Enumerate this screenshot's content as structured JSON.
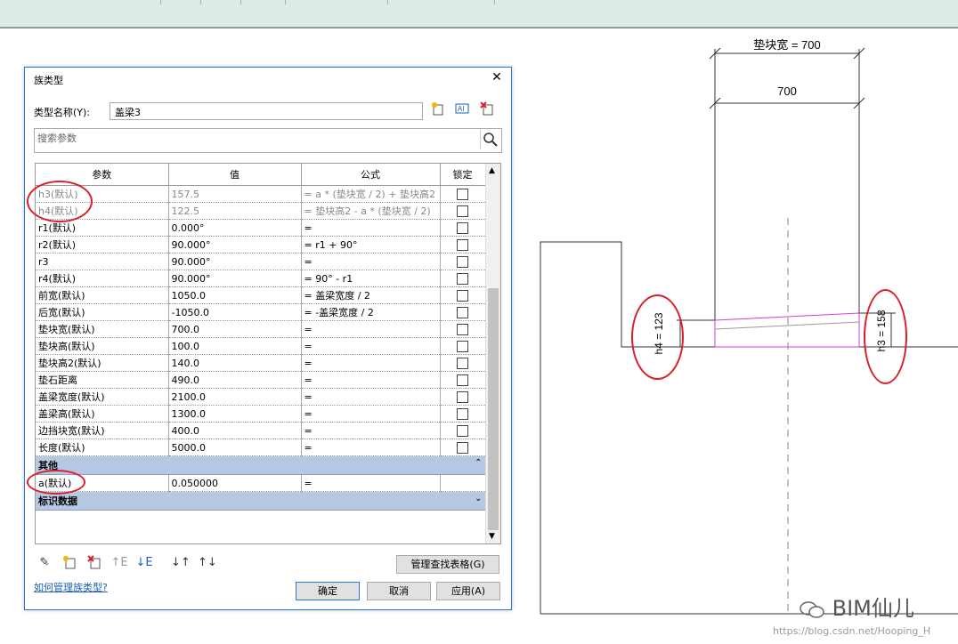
{
  "dialog": {
    "title": "族类型",
    "close_glyph": "✕",
    "type_name_label": "类型名称(Y):",
    "type_name_value": "盖梁3",
    "search_placeholder": "搜索参数",
    "columns": [
      "参数",
      "值",
      "公式",
      "锁定"
    ],
    "rows": [
      {
        "param": "h3(默认)",
        "value": "157.5",
        "formula": "= a * (垫块宽 / 2) + 垫块高2",
        "dim": true
      },
      {
        "param": "h4(默认)",
        "value": "122.5",
        "formula": "= 垫块高2 - a * (垫块宽 / 2)",
        "dim": true
      },
      {
        "param": "r1(默认)",
        "value": "0.000°",
        "formula": "=",
        "dim": false
      },
      {
        "param": "r2(默认)",
        "value": "90.000°",
        "formula": "= r1 + 90°",
        "dim": false
      },
      {
        "param": "r3",
        "value": "90.000°",
        "formula": "=",
        "dim": false
      },
      {
        "param": "r4(默认)",
        "value": "90.000°",
        "formula": "= 90° - r1",
        "dim": false
      },
      {
        "param": "前宽(默认)",
        "value": "1050.0",
        "formula": "= 盖梁宽度 / 2",
        "dim": false
      },
      {
        "param": "后宽(默认)",
        "value": "-1050.0",
        "formula": "= -盖梁宽度 / 2",
        "dim": false
      },
      {
        "param": "垫块宽(默认)",
        "value": "700.0",
        "formula": "=",
        "dim": false
      },
      {
        "param": "垫块高(默认)",
        "value": "100.0",
        "formula": "=",
        "dim": false
      },
      {
        "param": "垫块高2(默认)",
        "value": "140.0",
        "formula": "=",
        "dim": false
      },
      {
        "param": "垫石距离",
        "value": "490.0",
        "formula": "=",
        "dim": false
      },
      {
        "param": "盖梁宽度(默认)",
        "value": "2100.0",
        "formula": "=",
        "dim": false
      },
      {
        "param": "盖梁高(默认)",
        "value": "1300.0",
        "formula": "=",
        "dim": false
      },
      {
        "param": "边挡块宽(默认)",
        "value": "400.0",
        "formula": "=",
        "dim": false
      },
      {
        "param": "长度(默认)",
        "value": "5000.0",
        "formula": "=",
        "dim": false
      }
    ],
    "group_other": "其他",
    "row_a": {
      "param": "a(默认)",
      "value": "0.050000",
      "formula": "="
    },
    "group_identity": "标识数据",
    "manage_lookup_button": "管理查找表格(G)",
    "help_link": "如何管理族类型?",
    "ok_button": "确定",
    "cancel_button": "取消",
    "apply_button": "应用(A)"
  },
  "drawing": {
    "dim_top": "垫块宽 = 700",
    "dim_700": "700",
    "dim_h4": "h4 = 123",
    "dim_h3": "h3 = 158"
  },
  "watermark": {
    "brand": "BIM仙儿",
    "url": "https://blog.csdn.net/Hooping_H"
  },
  "colors": {
    "accent": "#2c78c8",
    "annotation": "#d9202a",
    "magenta": "#d23cd2",
    "group_bg": "#b7c8e3"
  }
}
